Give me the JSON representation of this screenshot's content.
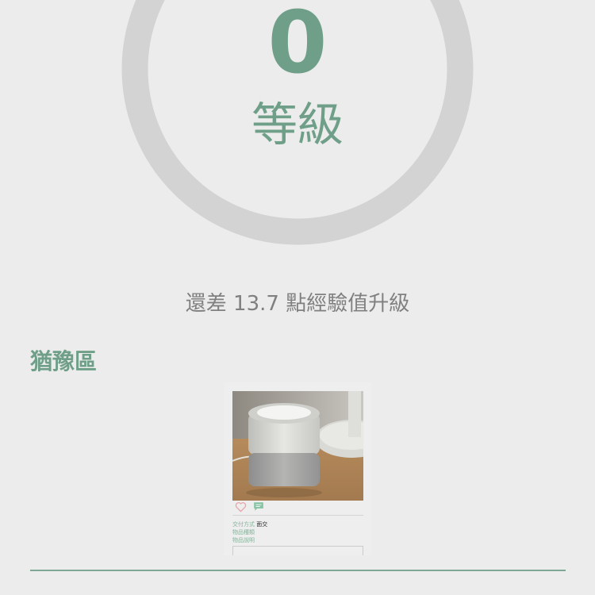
{
  "level": {
    "number": "0",
    "label": "等級",
    "progress_fraction": 0.12
  },
  "exp_message": "還差 13.7 點經驗值升級",
  "section": {
    "title": "猶豫區"
  },
  "card": {
    "delivery_label": "交付方式",
    "delivery_value": "面交",
    "item_type_label": "物品種類",
    "item_desc_label": "物品說明"
  },
  "colors": {
    "accent": "#6f9f88",
    "ring_track": "#d3d3d3",
    "ring_progress": "#e09595",
    "text_muted": "#808080",
    "background": "#ececec"
  },
  "icons": {
    "like": "heart-outline-icon",
    "comment": "chat-bubble-icon"
  }
}
